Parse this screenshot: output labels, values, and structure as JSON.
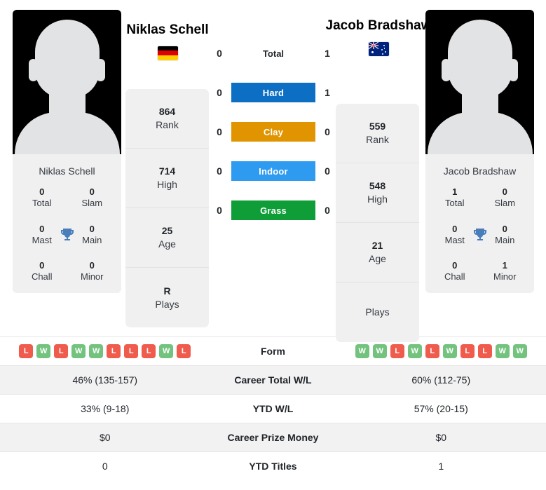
{
  "players": {
    "left": {
      "name": "Niklas Schell",
      "card_name": "Niklas Schell",
      "country": "Germany",
      "flag_icon": "flag-germany-icon",
      "avatar_icon": "player-avatar-placeholder-icon",
      "stats": [
        {
          "value": "864",
          "label": "Rank"
        },
        {
          "value": "714",
          "label": "High"
        },
        {
          "value": "25",
          "label": "Age"
        },
        {
          "value": "R",
          "label": "Plays"
        }
      ],
      "titles": [
        {
          "value": "0",
          "label": "Total"
        },
        {
          "value": "0",
          "label": "Slam"
        },
        {
          "value": "0",
          "label": "Mast"
        },
        {
          "value": "0",
          "label": "Main"
        },
        {
          "value": "0",
          "label": "Chall"
        },
        {
          "value": "0",
          "label": "Minor"
        }
      ],
      "form": [
        "L",
        "W",
        "L",
        "W",
        "W",
        "L",
        "L",
        "L",
        "W",
        "L"
      ]
    },
    "right": {
      "name": "Jacob Bradshaw",
      "card_name": "Jacob Bradshaw",
      "country": "Australia",
      "flag_icon": "flag-australia-icon",
      "avatar_icon": "player-avatar-placeholder-icon",
      "stats": [
        {
          "value": "559",
          "label": "Rank"
        },
        {
          "value": "548",
          "label": "High"
        },
        {
          "value": "21",
          "label": "Age"
        },
        {
          "value": "",
          "label": "Plays"
        }
      ],
      "titles": [
        {
          "value": "1",
          "label": "Total"
        },
        {
          "value": "0",
          "label": "Slam"
        },
        {
          "value": "0",
          "label": "Mast"
        },
        {
          "value": "0",
          "label": "Main"
        },
        {
          "value": "0",
          "label": "Chall"
        },
        {
          "value": "1",
          "label": "Minor"
        }
      ],
      "form": [
        "W",
        "W",
        "L",
        "W",
        "L",
        "W",
        "L",
        "L",
        "W",
        "W"
      ]
    }
  },
  "trophy_icon": "trophy-icon",
  "head_to_head": [
    {
      "label": "Total",
      "left": "0",
      "right": "1",
      "style": "plain",
      "color": ""
    },
    {
      "label": "Hard",
      "left": "0",
      "right": "1",
      "style": "surface",
      "color": "#0d6fc4"
    },
    {
      "label": "Clay",
      "left": "0",
      "right": "0",
      "style": "surface",
      "color": "#e09400"
    },
    {
      "label": "Indoor",
      "left": "0",
      "right": "0",
      "style": "surface",
      "color": "#2e9bf0"
    },
    {
      "label": "Grass",
      "left": "0",
      "right": "0",
      "style": "surface",
      "color": "#0f9d38"
    }
  ],
  "comparison_rows": [
    {
      "label": "Form",
      "left": "",
      "right": "",
      "type": "form"
    },
    {
      "label": "Career Total W/L",
      "left": "46% (135-157)",
      "right": "60% (112-75)",
      "type": "text"
    },
    {
      "label": "YTD W/L",
      "left": "33% (9-18)",
      "right": "57% (20-15)",
      "type": "text"
    },
    {
      "label": "Career Prize Money",
      "left": "$0",
      "right": "$0",
      "type": "text"
    },
    {
      "label": "YTD Titles",
      "left": "0",
      "right": "1",
      "type": "text"
    }
  ],
  "colors": {
    "hard": "#0d6fc4",
    "clay": "#e09400",
    "indoor": "#2e9bf0",
    "grass": "#0f9d38",
    "win": "#73c37f",
    "loss": "#ef5b4c",
    "card_bg": "#f0f0f1"
  }
}
